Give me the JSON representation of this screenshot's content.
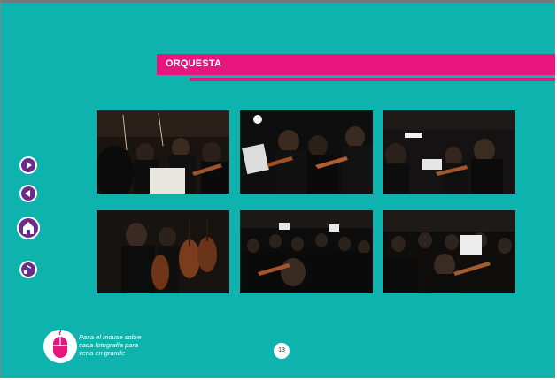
{
  "section": {
    "title": "ORQUESTA"
  },
  "gallery": {
    "photos": [
      {
        "description": "orchestra-violins-1"
      },
      {
        "description": "orchestra-violins-2"
      },
      {
        "description": "orchestra-violins-3"
      },
      {
        "description": "orchestra-cellos"
      },
      {
        "description": "orchestra-wide-1"
      },
      {
        "description": "orchestra-wide-2"
      }
    ]
  },
  "navigation": {
    "icons": [
      "play-next-icon",
      "play-back-icon",
      "home-icon",
      "music-note-icon"
    ]
  },
  "hint": {
    "lines": [
      "Pasa el mouse sobre",
      "cada fotografía para",
      "verla en grande"
    ],
    "icon": "mouse-icon"
  },
  "page": {
    "number": "13"
  },
  "colors": {
    "background": "#0fb3ad",
    "accent": "#e8157f",
    "icon": "#6a2c8f"
  }
}
